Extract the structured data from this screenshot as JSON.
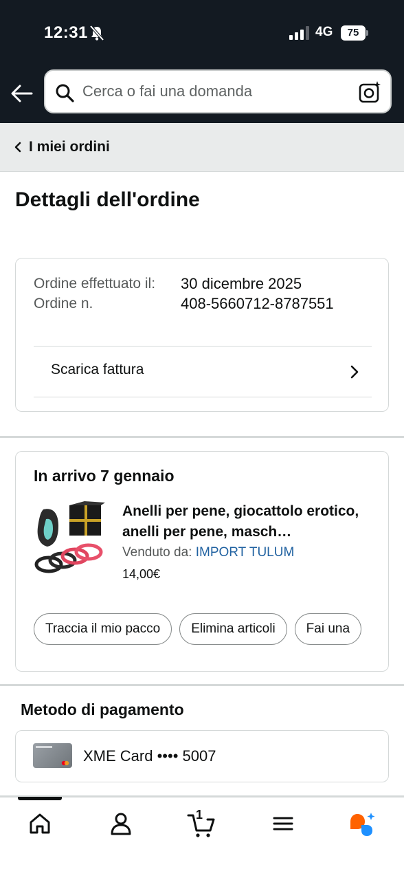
{
  "status_bar": {
    "time": "12:31",
    "network": "4G",
    "battery": "75"
  },
  "search": {
    "placeholder": "Cerca o fai una domanda"
  },
  "breadcrumb": {
    "label": "I miei ordini"
  },
  "page_title": "Dettagli dell'ordine",
  "order_info": {
    "placed_label": "Ordine effettuato il:",
    "number_label": "Ordine n.",
    "placed_date": "30 dicembre 2025",
    "order_number": "408-5660712-8787551",
    "invoice_label": "Scarica fattura"
  },
  "shipment": {
    "arrival": "In arrivo 7 gennaio",
    "product_title": "Anelli per pene, giocattolo erotico, anelli per pene, masch…",
    "sold_by_label": "Venduto da: ",
    "seller": "IMPORT TULUM",
    "price": "14,00€",
    "actions": [
      "Traccia il mio pacco",
      "Elimina articoli",
      "Fai una"
    ]
  },
  "payment": {
    "title": "Metodo di pagamento",
    "card": "XME Card •••• 5007"
  },
  "bottom_nav": {
    "cart_count": "1",
    "items": [
      "home-icon",
      "account-icon",
      "cart-icon",
      "menu-icon",
      "rufus-icon"
    ]
  },
  "colors": {
    "header_bg": "#131a22",
    "link": "#2162a1",
    "accent_orange": "#ff6200",
    "accent_blue": "#1e90ff"
  }
}
